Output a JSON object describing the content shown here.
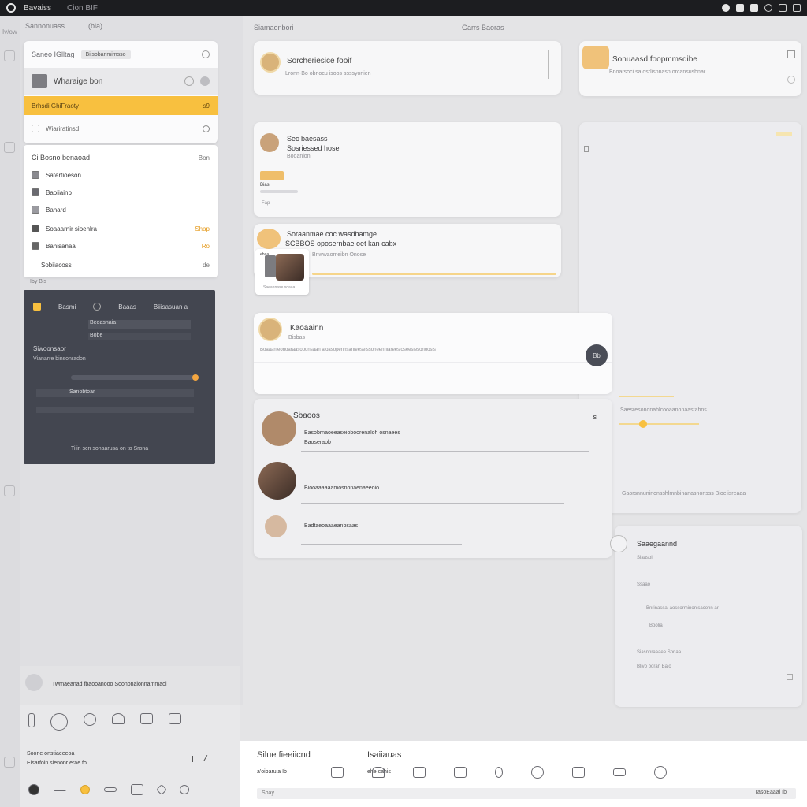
{
  "topbar": {
    "title": "Bavaiss",
    "subtitle": "Cion BIF"
  },
  "left_rail": {
    "label": "Iv/ow"
  },
  "left_panel": {
    "header_label": "Sannonuass",
    "header_label_2": "(bia)",
    "search_label": "Saneo IGlltag",
    "search_chip": "Biisobanmimsso",
    "profile_name": "Wharaige bon",
    "highlight_item": "Brhsdi GhiFraoty",
    "highlight_badge": "s9",
    "menu_item": "Wiariratinsd",
    "list_title": "Ci Bosno benaoad",
    "list_badge": "Bon",
    "list_items": [
      {
        "label": "Satertioeson",
        "right": ""
      },
      {
        "label": "Baoiiainp",
        "right": ""
      },
      {
        "label": "Banard",
        "right": ""
      },
      {
        "label": "Soaaarnir sioenlra",
        "right": "Shap"
      },
      {
        "label": "Bahisanaa",
        "right": "Ro"
      },
      {
        "label": "Sobiiacoss",
        "right": "de"
      }
    ],
    "footer_label": "Iby Bis"
  },
  "dark_panel": {
    "tab_1": "Basmi",
    "tab_2": "Baaas",
    "tab_3": "Biiisasuan a",
    "field_1": "Beoasnaia",
    "field_2": "Bobe",
    "section_title": "Siwoonsaor",
    "section_sub": "Vianarre binsonradon",
    "row_2": "Sanobtoar",
    "footer": "Tiiin scn sonaarusa on to Srona"
  },
  "top_center": {
    "label_left": "Siamaonbori",
    "label_mid": "Garrs Baoras"
  },
  "cards": {
    "card1_title": "Sorcheriesice fooif",
    "card1_sub": "Lronn-Bo obnocu isoos ssssyonien",
    "card2_title": "Sonuaasd foopmmsdibe",
    "card2_sub": "Bnoarsoci sa osrlisnnasn orcansusbnar",
    "card3_title": "Sec baesass",
    "card3_sub": "Sosriessed hose",
    "card3_meta": "Booanion",
    "card3_tag": "Bias",
    "card3_foot": "Fap",
    "card4_title": "Soraanmae coc wasdhamge",
    "card4_sub": "SCBBOS oposernbae oet kan cabx",
    "card4_meta": "Bnwwaomeibn Onose",
    "card4_photo_caption": "Saeannase soaaa",
    "card4_photo_tag": "ebaa",
    "notice_title": "Kaoaainn",
    "notice_sub": "Bisbas",
    "notice_button": "Bb",
    "notice_body": "Boaaanieonoaraasooonsaan aioasopennsanieeseissoneenniareesioseesiesonoosis",
    "chat_title": "Sbaoos",
    "chat_close": "s",
    "chat_items": [
      {
        "line1": "Basobrnaoeeaseioboorenaloh osnaees",
        "line2": "Baoseraob"
      },
      {
        "line1": "Biooaaaaaamosnonaenaeeoio",
        "line2": ""
      },
      {
        "line1": "Badtaeoaaaeanbsaas",
        "line2": ""
      }
    ]
  },
  "right_panel": {
    "slider_label": "Saesresononahlcooaanonaastahns",
    "slider_value": 0.1,
    "slider_footer": "Gaorsnnuninonsshlmnbinanasnonsss Bioeiisreaaa",
    "settings_title": "Saaegaannd",
    "settings_lines": [
      "Siaasoi",
      "Ssaao",
      "Bnrinassal aossorminonisaconn ar",
      "Boolia",
      "Siasnnraaaee  Soriaa",
      "Blivo boran  Baio"
    ]
  },
  "bottom_left": {
    "status_text": "Twrnaeanad fbaooanooo Soononaionnammaol",
    "recent_label": "Soone onstiaeeeoa",
    "recent_sub": "Eisarfoin sienonr erae fo"
  },
  "bottom_right": {
    "title": "Silue fieeiicnd",
    "title_2": "Isaiiauas",
    "sub_label": "a'oibaruia Ib",
    "sub_label_2": "ehe cahis",
    "search_placeholder": "Sbay",
    "footer_right": "TasoEaaai Ib"
  },
  "colors": {
    "accent": "#f8c03f",
    "dark_panel": "#434650",
    "topbar": "#1c1d20"
  }
}
